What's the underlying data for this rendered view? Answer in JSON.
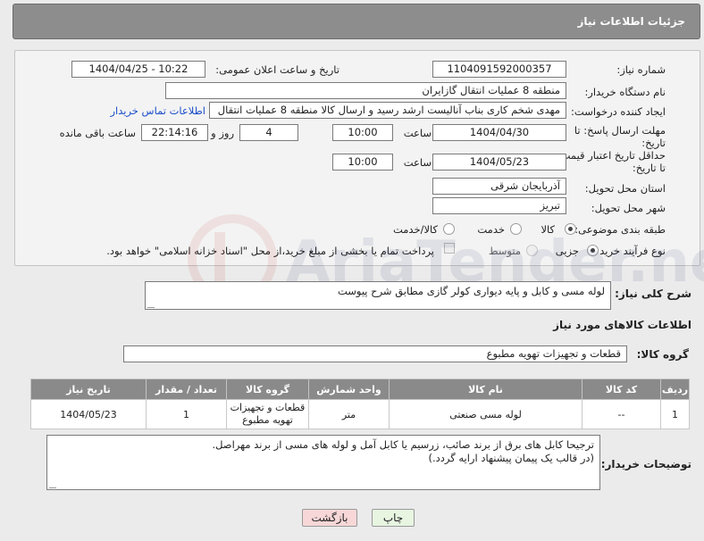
{
  "page": {
    "header_title": "جزئیات اطلاعات نیاز"
  },
  "form": {
    "need_number_label": "شماره نیاز:",
    "need_number": "1104091592000357",
    "announce_label": "تاریخ و ساعت اعلان عمومی:",
    "announce_value": "1404/04/25 - 10:22",
    "buyer_label": "نام دستگاه خریدار:",
    "buyer_value": "منطقه 8 عملیات انتقال گازایران",
    "creator_label": "ایجاد کننده درخواست:",
    "creator_value": "مهدی شخم کاری بناب آنالیست ارشد رسید و ارسال کالا منطقه 8 عملیات انتقال",
    "contact_link": "اطلاعات تماس خریدار",
    "deadline_label_1": "مهلت ارسال پاسخ: تا",
    "deadline_label_2": "تاریخ:",
    "deadline_date": "1404/04/30",
    "time_label": "ساعت",
    "deadline_time": "10:00",
    "days_value": "4",
    "days_label": "روز و",
    "remaining_time": "22:14:16",
    "remaining_label": "ساعت باقی مانده",
    "validity_label_1": "حداقل تاریخ اعتبار قیمت:",
    "validity_label_2": "تا تاریخ:",
    "validity_date": "1404/05/23",
    "validity_time": "10:00",
    "province_label": "استان محل تحویل:",
    "province_value": "آذربایجان شرقی",
    "city_label": "شهر محل تحویل:",
    "city_value": "تبریز",
    "category_label": "طبقه بندی موضوعی:",
    "category_options": [
      "کالا",
      "خدمت",
      "کالا/خدمت"
    ],
    "process_label": "نوع فرآیند خرید :",
    "process_options": [
      "جزیی",
      "متوسط"
    ],
    "payment_note": "پرداخت تمام یا بخشی از مبلغ خرید،از محل \"اسناد خزانه اسلامی\" خواهد بود."
  },
  "summary": {
    "label": "شرح کلی نیاز:",
    "value": "لوله مسی و کابل و پایه دیواری کولر گازی مطابق شرح پیوست"
  },
  "goods": {
    "section_title": "اطلاعات کالاهای مورد نیاز",
    "group_label": "گروه کالا:",
    "group_value": "قطعات و تجهیزات تهویه مطبوع",
    "columns": [
      "ردیف",
      "کد کالا",
      "نام کالا",
      "واحد شمارش",
      "گروه کالا",
      "تعداد / مقدار",
      "تاریخ نیاز"
    ],
    "rows": [
      {
        "row": "1",
        "code": "--",
        "name": "لوله مسی صنعتی",
        "unit": "متر",
        "group_line1": "قطعات و تجهیزات",
        "group_line2": "تهویه مطبوع",
        "qty": "1",
        "date": "1404/05/23"
      }
    ]
  },
  "buyer_notes": {
    "label": "توضیحات خریدار:",
    "line1": "ترجیحا کابل های برق از برند صائب، زرسیم یا کابل آمل و لوله های مسی از برند مهراصل.",
    "line2": "(در قالب یک پیمان پیشنهاد ارایه گردد.)"
  },
  "buttons": {
    "print": "چاپ",
    "back": "بازگشت"
  },
  "colors": {
    "header_bg": "#8d8d8d",
    "print_btn_bg": "#e7f5e1",
    "back_btn_bg": "#f7d7d7",
    "link": "#1a4dc9"
  }
}
